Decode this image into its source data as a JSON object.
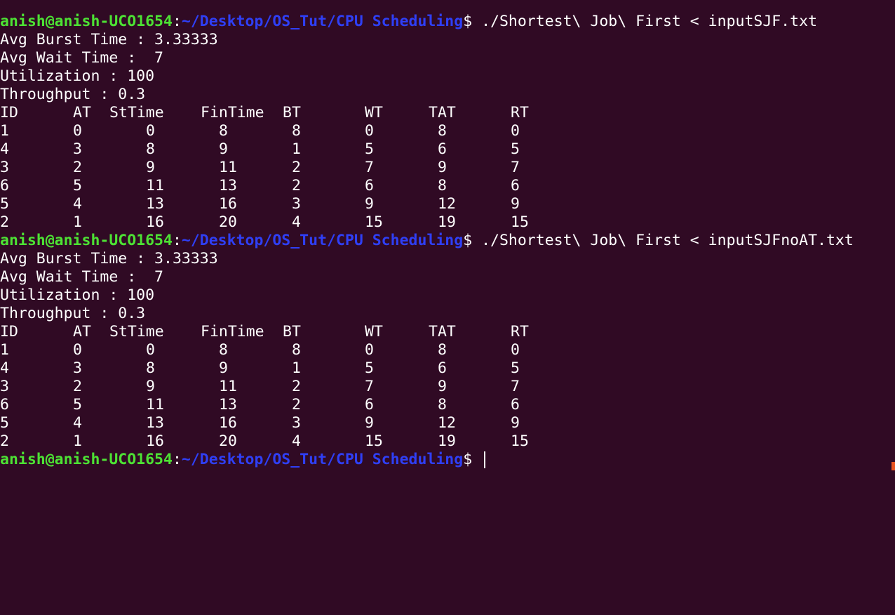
{
  "prompt": {
    "user_host": "anish@anish-UCO1654",
    "separator": ":",
    "path": "~/Desktop/OS_Tut/CPU Scheduling",
    "dollar": "$"
  },
  "runs": [
    {
      "command": " ./Shortest\\ Job\\ First < inputSJF.txt",
      "stats": [
        "Avg Burst Time : 3.33333",
        "Avg Wait Time :  7",
        "Utilization : 100",
        "Throughput : 0.3"
      ],
      "headers": [
        "ID",
        "AT",
        "StTime",
        "FinTime",
        "BT",
        "WT",
        "TAT",
        "RT"
      ],
      "rows": [
        [
          "1",
          "0",
          "0",
          "8",
          "8",
          "0",
          "8",
          "0"
        ],
        [
          "4",
          "3",
          "8",
          "9",
          "1",
          "5",
          "6",
          "5"
        ],
        [
          "3",
          "2",
          "9",
          "11",
          "2",
          "7",
          "9",
          "7"
        ],
        [
          "6",
          "5",
          "11",
          "13",
          "2",
          "6",
          "8",
          "6"
        ],
        [
          "5",
          "4",
          "13",
          "16",
          "3",
          "9",
          "12",
          "9"
        ],
        [
          "2",
          "1",
          "16",
          "20",
          "4",
          "15",
          "19",
          "15"
        ]
      ]
    },
    {
      "command": " ./Shortest\\ Job\\ First < inputSJFnoAT.txt",
      "stats": [
        "Avg Burst Time : 3.33333",
        "Avg Wait Time :  7",
        "Utilization : 100",
        "Throughput : 0.3"
      ],
      "headers": [
        "ID",
        "AT",
        "StTime",
        "FinTime",
        "BT",
        "WT",
        "TAT",
        "RT"
      ],
      "rows": [
        [
          "1",
          "0",
          "0",
          "8",
          "8",
          "0",
          "8",
          "0"
        ],
        [
          "4",
          "3",
          "8",
          "9",
          "1",
          "5",
          "6",
          "5"
        ],
        [
          "3",
          "2",
          "9",
          "11",
          "2",
          "7",
          "9",
          "7"
        ],
        [
          "6",
          "5",
          "11",
          "13",
          "2",
          "6",
          "8",
          "6"
        ],
        [
          "5",
          "4",
          "13",
          "16",
          "3",
          "9",
          "12",
          "9"
        ],
        [
          "2",
          "1",
          "16",
          "20",
          "4",
          "15",
          "19",
          "15"
        ]
      ]
    }
  ],
  "final_prompt": {
    "command": " "
  },
  "colors": {
    "background": "#300a24",
    "user_host": "#4de234",
    "path": "#2f3ff5",
    "text": "#ffffff"
  }
}
